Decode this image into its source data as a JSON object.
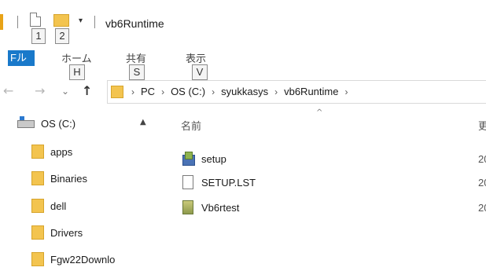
{
  "window": {
    "title": "vb6Runtime"
  },
  "quick_access": {
    "keytip_1": "1",
    "keytip_2": "2",
    "dropdown_glyph": "▾"
  },
  "ribbon": {
    "file_tab": "Fル",
    "tabs": [
      {
        "label": "ホーム",
        "keytip": "H"
      },
      {
        "label": "共有",
        "keytip": "S"
      },
      {
        "label": "表示",
        "keytip": "V"
      }
    ]
  },
  "navigation": {
    "back_icon": "←",
    "forward_icon": "→",
    "recent_icon": "⌄",
    "up_icon": "↑",
    "breadcrumb": [
      "PC",
      "OS (C:)",
      "syukkasys",
      "vb6Runtime"
    ],
    "separator": "›"
  },
  "nav_pane": {
    "drive": "OS (C:)",
    "scroll_up": "▲",
    "folders": [
      "apps",
      "Binaries",
      "dell",
      "Drivers",
      "Fgw22Downlo"
    ]
  },
  "file_list": {
    "column_name": "名前",
    "column_date_partial": "更",
    "sort_arrow": "^",
    "files": [
      {
        "name": "setup",
        "icon": "setup-icon",
        "date_partial": "20"
      },
      {
        "name": "SETUP.LST",
        "icon": "document-icon",
        "date_partial": "20"
      },
      {
        "name": "Vb6rtest",
        "icon": "executable-icon",
        "date_partial": "20"
      }
    ]
  }
}
